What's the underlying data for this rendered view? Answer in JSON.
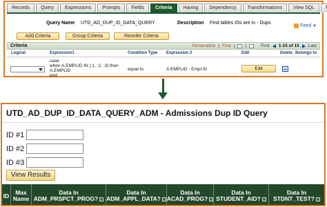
{
  "tabs": [
    "Records",
    "Query",
    "Expressions",
    "Prompts",
    "Fields",
    "Criteria",
    "Having",
    "Dependency",
    "Transformations",
    "View SQL",
    "Run"
  ],
  "active_tab": "Criteria",
  "query": {
    "name_label": "Query Name",
    "name_value": "UTD_AD_DUP_ID_DATA_QUERY",
    "description_label": "Description",
    "description_value": "Find tables IDs are in - Dups",
    "feed_label": "Feed"
  },
  "toolbar": {
    "add_criteria": "Add Criteria",
    "group_criteria": "Group Criteria",
    "reorder_criteria": "Reorder Criteria"
  },
  "criteria": {
    "title": "Criteria",
    "personalize": "Personalize",
    "find": "Find",
    "first": "First",
    "range": "1-15 of 15",
    "last": "Last",
    "columns": {
      "logical": "Logical",
      "expression1": "Expression1",
      "condition_type": "Condition Type",
      "expression2": "Expression 2",
      "edit": "Edit",
      "delete": "Delete",
      "belongs_to": "Belongs to"
    },
    "row": {
      "expression1": "case\nwhen A.EMPLID IN (:1, :2, :3) then\nA.EMPLID\nend",
      "condition_type": "equal to",
      "expression2": "A.EMPLID - Empl ID",
      "edit_label": "Edit"
    }
  },
  "page": {
    "title": "UTD_AD_DUP_ID_DATA_QUERY_ADM - Admissions Dup ID Query",
    "id1_label": "ID #1",
    "id2_label": "ID #2",
    "id3_label": "ID #3",
    "view_results": "View Results"
  },
  "results": {
    "columns": [
      {
        "line1": "ID",
        "line2": ""
      },
      {
        "line1": "Max",
        "line2": "Name"
      },
      {
        "line1": "Data In",
        "line2": "ADM_PRSPCT_PROG?"
      },
      {
        "line1": "Data In",
        "line2": "ADM_APPL_DATA?"
      },
      {
        "line1": "Data In",
        "line2": "ACAD_PROG?"
      },
      {
        "line1": "Data In",
        "line2": "STUDENT_AID?"
      },
      {
        "line1": "Data In",
        "line2": "STDNT_TEST?"
      }
    ]
  },
  "colors": {
    "panel_border": "#e0771f",
    "tab_active": "#1c5a2e",
    "header_bg": "#24482a",
    "link": "#b5451b"
  }
}
